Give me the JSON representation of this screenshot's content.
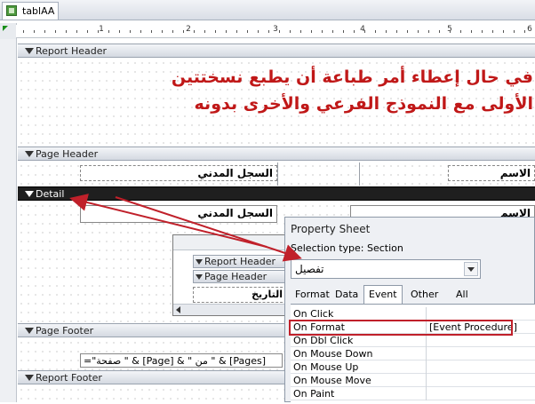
{
  "window": {
    "tab_title": "tablAA"
  },
  "ruler": {
    "numbers": [
      "1",
      "2",
      "3",
      "4",
      "5",
      "6"
    ]
  },
  "sections": {
    "report_header": "Report Header",
    "page_header": "Page Header",
    "detail": "Detail",
    "page_footer": "Page Footer",
    "report_footer": "Report Footer"
  },
  "annotation": {
    "line1": "في حال إعطاء أمر طباعة أن يطبع نسختتين",
    "line2": "الأولى مع النموذج الفرعي والأخرى بدونه"
  },
  "page_header_labels": {
    "name": "الاسم",
    "civil_record": "السجل المدني"
  },
  "detail_fields": {
    "name": "الاسم",
    "civil_record": "السجل المدني"
  },
  "subreport": {
    "report_header": "Report Header",
    "page_header": "Page Header",
    "date_label": "التاريخ"
  },
  "page_footer_expression": "=\"صفحة \" & [Page] & \" من \" & [Pages]",
  "property_sheet": {
    "title": "Property Sheet",
    "selection_type": "Selection type:  Section",
    "selected": "تفصيل",
    "tabs": [
      "Format",
      "Data",
      "Event",
      "Other",
      "All"
    ],
    "active_tab": "Event",
    "rows": [
      {
        "name": "On Click",
        "value": ""
      },
      {
        "name": "On Format",
        "value": "[Event Procedure]"
      },
      {
        "name": "On Dbl Click",
        "value": ""
      },
      {
        "name": "On Mouse Down",
        "value": ""
      },
      {
        "name": "On Mouse Up",
        "value": ""
      },
      {
        "name": "On Mouse Move",
        "value": ""
      },
      {
        "name": "On Paint",
        "value": ""
      }
    ]
  },
  "colors": {
    "annotation": "#c01818",
    "highlight": "#c0202a",
    "detail_bar": "#1f1f1f"
  }
}
